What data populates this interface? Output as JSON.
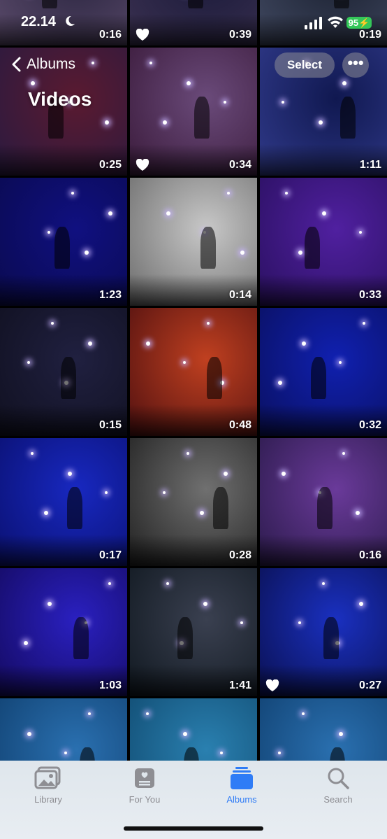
{
  "status_bar": {
    "time": "22.14",
    "battery": "95"
  },
  "header": {
    "back_label": "Albums",
    "title": "Videos",
    "select_label": "Select",
    "more_label": "•••"
  },
  "videos": [
    {
      "duration": "0:16",
      "favorite": false,
      "colors": [
        "#2a2540",
        "#5a4a6a"
      ]
    },
    {
      "duration": "0:39",
      "favorite": true,
      "colors": [
        "#1a1a3a",
        "#3a3050"
      ]
    },
    {
      "duration": "0:19",
      "favorite": false,
      "colors": [
        "#1a2030",
        "#404860"
      ]
    },
    {
      "duration": "0:25",
      "favorite": false,
      "colors": [
        "#5a1a30",
        "#2a1a40"
      ]
    },
    {
      "duration": "0:34",
      "favorite": true,
      "colors": [
        "#6a4a7a",
        "#3a1a3a"
      ]
    },
    {
      "duration": "1:11",
      "favorite": false,
      "colors": [
        "#101850",
        "#303a8a"
      ]
    },
    {
      "duration": "1:23",
      "favorite": false,
      "colors": [
        "#101080",
        "#0a0a50"
      ]
    },
    {
      "duration": "0:14",
      "favorite": false,
      "colors": [
        "#c8c8c8",
        "#6a6a6a"
      ]
    },
    {
      "duration": "0:33",
      "favorite": false,
      "colors": [
        "#5020a0",
        "#2a1060"
      ]
    },
    {
      "duration": "0:15",
      "favorite": false,
      "colors": [
        "#202040",
        "#101020"
      ]
    },
    {
      "duration": "0:48",
      "favorite": false,
      "colors": [
        "#c04020",
        "#501010"
      ]
    },
    {
      "duration": "0:32",
      "favorite": false,
      "colors": [
        "#1020b0",
        "#0a1060"
      ]
    },
    {
      "duration": "0:17",
      "favorite": false,
      "colors": [
        "#1828c0",
        "#0a1070"
      ]
    },
    {
      "duration": "0:28",
      "favorite": false,
      "colors": [
        "#707070",
        "#202020"
      ]
    },
    {
      "duration": "0:16",
      "favorite": false,
      "colors": [
        "#6a3a9a",
        "#2a1a4a"
      ]
    },
    {
      "duration": "1:03",
      "favorite": false,
      "colors": [
        "#2a20c0",
        "#140a60"
      ]
    },
    {
      "duration": "1:41",
      "favorite": false,
      "colors": [
        "#3a4050",
        "#101820"
      ]
    },
    {
      "duration": "0:27",
      "favorite": true,
      "colors": [
        "#1a30c0",
        "#0a1050"
      ]
    },
    {
      "duration": "",
      "favorite": false,
      "colors": [
        "#2a70b0",
        "#104070"
      ]
    },
    {
      "duration": "",
      "favorite": false,
      "colors": [
        "#2a80b0",
        "#104a70"
      ]
    },
    {
      "duration": "",
      "favorite": false,
      "colors": [
        "#2a70b0",
        "#104070"
      ]
    }
  ],
  "tabs": [
    {
      "label": "Library",
      "icon": "library-icon",
      "active": false
    },
    {
      "label": "For You",
      "icon": "for-you-icon",
      "active": false
    },
    {
      "label": "Albums",
      "icon": "albums-icon",
      "active": true
    },
    {
      "label": "Search",
      "icon": "search-icon",
      "active": false
    }
  ],
  "accent_color": "#2f7cf6"
}
